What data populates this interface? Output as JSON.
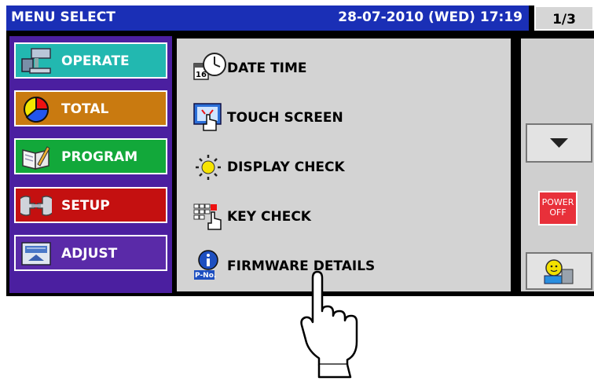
{
  "titlebar": {
    "title": "MENU SELECT",
    "datetime": "28-07-2010 (WED) 17:19",
    "page": "1/3"
  },
  "categories": [
    {
      "label": "OPERATE",
      "color": "#22b8b0",
      "icon": "operate-terminal-icon"
    },
    {
      "label": "TOTAL",
      "color": "#c97a10",
      "icon": "pie-chart-icon"
    },
    {
      "label": "PROGRAM",
      "color": "#12a83a",
      "icon": "book-icon"
    },
    {
      "label": "SETUP",
      "color": "#c41010",
      "icon": "wrench-icon"
    },
    {
      "label": "ADJUST",
      "color": "#5a2aa8",
      "icon": "scale-icon"
    }
  ],
  "menu_items": [
    {
      "label": "DATE TIME",
      "icon": "calendar-clock-icon"
    },
    {
      "label": "TOUCH SCREEN",
      "icon": "touch-screen-icon"
    },
    {
      "label": "DISPLAY CHECK",
      "icon": "sun-icon"
    },
    {
      "label": "KEY CHECK",
      "icon": "key-check-icon"
    },
    {
      "label": "FIRMWARE DETAILS",
      "icon": "info-pno-icon"
    }
  ],
  "icon_text": {
    "calendar_day": "16",
    "pno": "P-No."
  },
  "right": {
    "power_line1": "POWER",
    "power_line2": "OFF"
  },
  "colors": {
    "title_bar": "#1a2fb6",
    "left_panel": "#4b1fa0",
    "center_panel": "#d3d3d3",
    "power": "#e8303a"
  }
}
